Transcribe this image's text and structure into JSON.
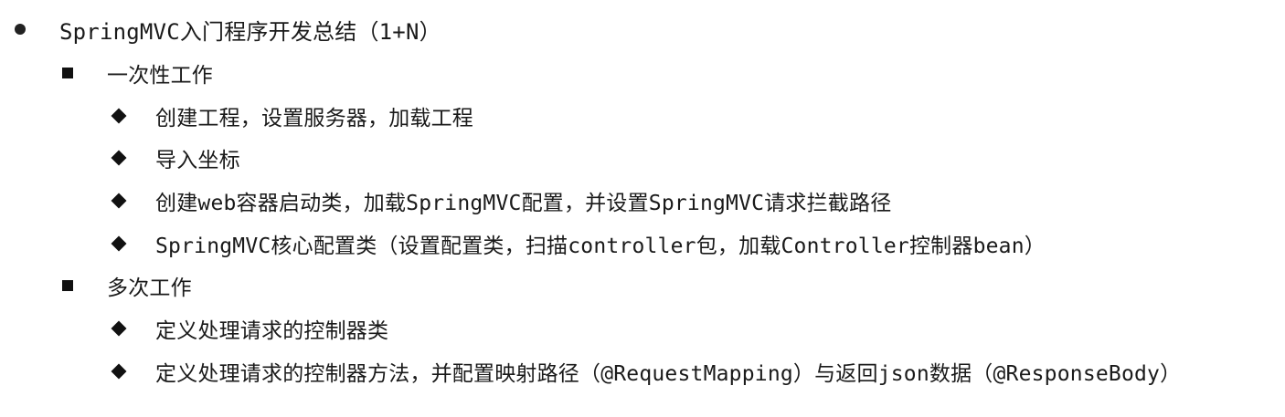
{
  "title": "SpringMVC入门程序开发总结（1+N）",
  "groups": [
    {
      "label": "一次性工作",
      "items": [
        "创建工程，设置服务器，加载工程",
        "导入坐标",
        "创建web容器启动类，加载SpringMVC配置，并设置SpringMVC请求拦截路径",
        "SpringMVC核心配置类（设置配置类，扫描controller包，加载Controller控制器bean）"
      ]
    },
    {
      "label": "多次工作",
      "items": [
        "定义处理请求的控制器类",
        "定义处理请求的控制器方法，并配置映射路径（@RequestMapping）与返回json数据（@ResponseBody）"
      ]
    }
  ]
}
